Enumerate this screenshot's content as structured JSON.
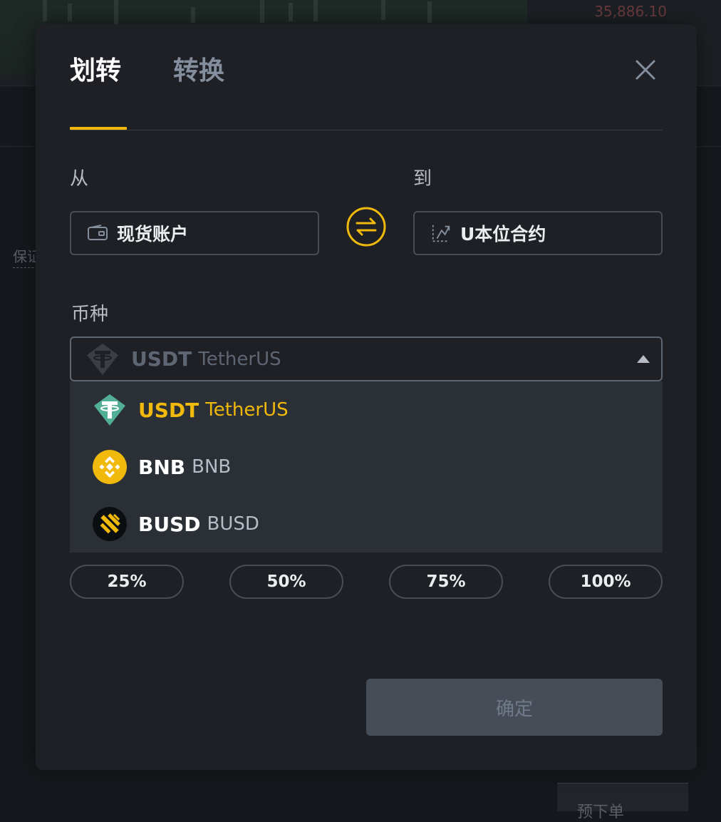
{
  "background": {
    "price": "35,886.10",
    "side_label": "保证",
    "bottom_button": "预下单"
  },
  "modal": {
    "tabs": [
      {
        "label": "划转",
        "active": true
      },
      {
        "label": "转换",
        "active": false
      }
    ],
    "from_label": "从",
    "to_label": "到",
    "from_account": {
      "icon": "wallet-icon",
      "label": "现货账户"
    },
    "to_account": {
      "icon": "futures-icon",
      "label": "U本位合约"
    },
    "swap_icon": "swap-arrows-icon",
    "coin_label": "币种",
    "coin_select": {
      "symbol": "USDT",
      "name": "TetherUS",
      "icon": "tether-icon"
    },
    "coin_options": [
      {
        "symbol": "USDT",
        "name": "TetherUS",
        "icon": "tether-icon",
        "active": true
      },
      {
        "symbol": "BNB",
        "name": "BNB",
        "icon": "bnb-icon",
        "active": false
      },
      {
        "symbol": "BUSD",
        "name": "BUSD",
        "icon": "busd-icon",
        "active": false
      }
    ],
    "percent_buttons": [
      "25%",
      "50%",
      "75%",
      "100%"
    ],
    "confirm_label": "确定"
  },
  "colors": {
    "accent": "#f0b90b",
    "modal_bg": "#1e2026",
    "dropdown_bg": "#2b2f36",
    "tether": "#50af95"
  }
}
